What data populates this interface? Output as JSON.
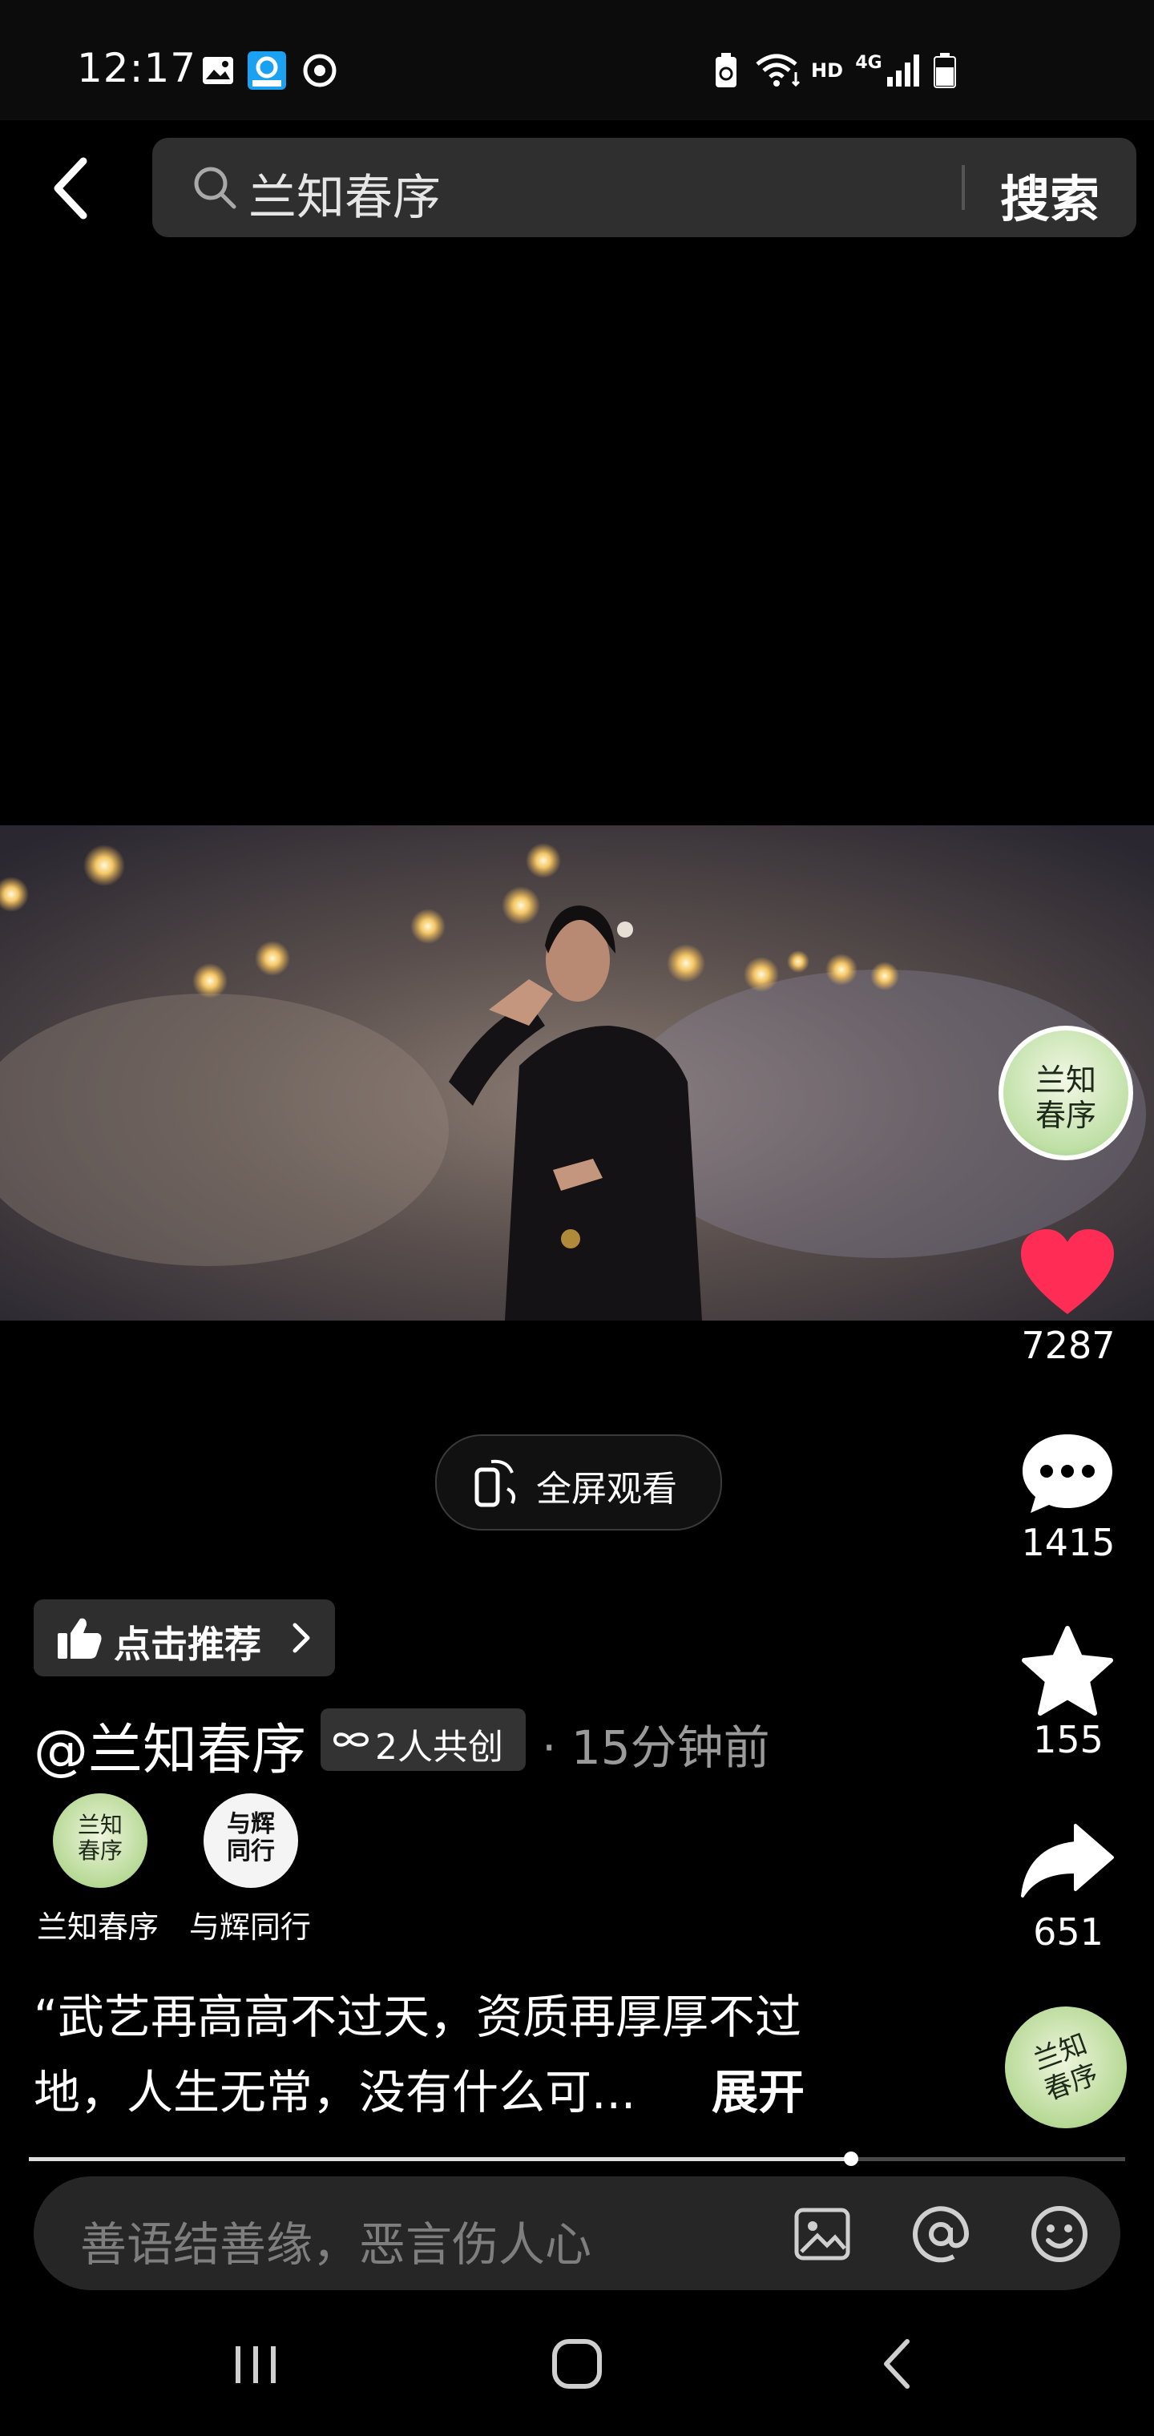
{
  "status_bar": {
    "time": "12:17",
    "left_icons": [
      "gallery-icon",
      "app-notification-icon",
      "sync-icon"
    ],
    "right_icons": [
      "battery-saver-icon",
      "wifi-icon",
      "hd-icon",
      "4g-signal-icon",
      "battery-icon"
    ],
    "hd_label": "HD",
    "network_label": "4G"
  },
  "header": {
    "search_query": "兰知春序",
    "search_button": "搜索"
  },
  "video": {
    "fullscreen_label": "全屏观看"
  },
  "actions": {
    "likes": "7287",
    "comments": "1415",
    "favorites": "155",
    "shares": "651",
    "avatar_text": [
      "兰知",
      "春序"
    ],
    "like_color": "#ff2c55"
  },
  "post": {
    "recommend_label": "点击推荐",
    "author": "@兰知春序",
    "collab_label": "2人共创",
    "time_ago": "· 15分钟前",
    "co_creators": [
      {
        "name": "兰知春序",
        "avatar_text": [
          "兰知",
          "春序"
        ]
      },
      {
        "name": "与辉同行",
        "avatar_text": [
          "与辉",
          "同行"
        ]
      }
    ],
    "description_line1": "“武艺再高高不过天，资质再厚厚不过",
    "description_line2": "地，人生无常，没有什么可...",
    "expand_label": "展开",
    "progress": 0.75
  },
  "comment_bar": {
    "placeholder": "善语结善缘，恶言伤人心"
  },
  "nav_bar": {
    "buttons": [
      "recent-apps",
      "home",
      "back"
    ]
  }
}
